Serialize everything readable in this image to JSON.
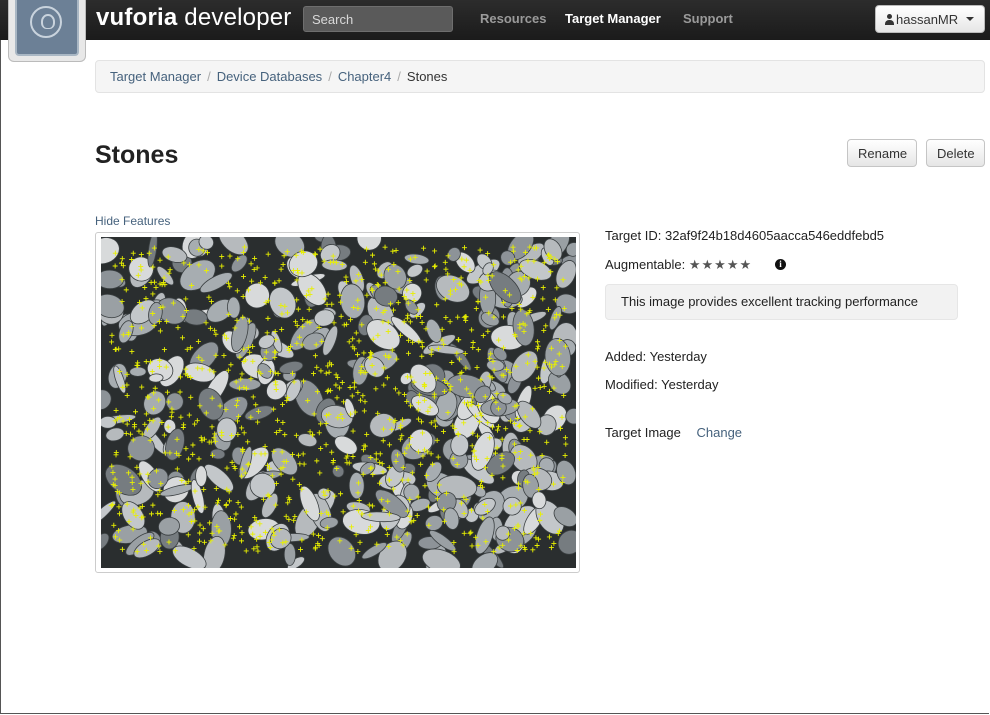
{
  "navbar": {
    "brand_bold": "vuforia",
    "brand_light": " developer",
    "search_placeholder": "Search",
    "items": [
      {
        "label": "Resources",
        "active": false
      },
      {
        "label": "Target Manager",
        "active": true
      },
      {
        "label": "Support",
        "active": false
      }
    ],
    "user": "hassanMR"
  },
  "breadcrumb": {
    "items": [
      "Target Manager",
      "Device Databases",
      "Chapter4"
    ],
    "current": "Stones"
  },
  "page": {
    "title": "Stones",
    "rename_label": "Rename",
    "delete_label": "Delete",
    "hide_features_label": "Hide Features"
  },
  "details": {
    "target_id_label": "Target ID:",
    "target_id": "32af9f24b18d4605aacca546eddfebd5",
    "augmentable_label": "Augmentable:",
    "augmentable_rating": 5,
    "augmentable_max": 5,
    "tracking_message": "This image provides excellent tracking performance",
    "added_label": "Added:",
    "added": "Yesterday",
    "modified_label": "Modified:",
    "modified": "Yesterday",
    "target_image_label": "Target Image",
    "change_label": "Change"
  },
  "icons": {
    "logo": "vuforia-logo-icon",
    "user": "person-icon",
    "dropdown": "caret-down-icon",
    "info": "info-icon",
    "rating": "star-icon"
  },
  "colors": {
    "navbar": "#1b1b1b",
    "link": "#46627d",
    "feature_marker": "#e8f000"
  }
}
